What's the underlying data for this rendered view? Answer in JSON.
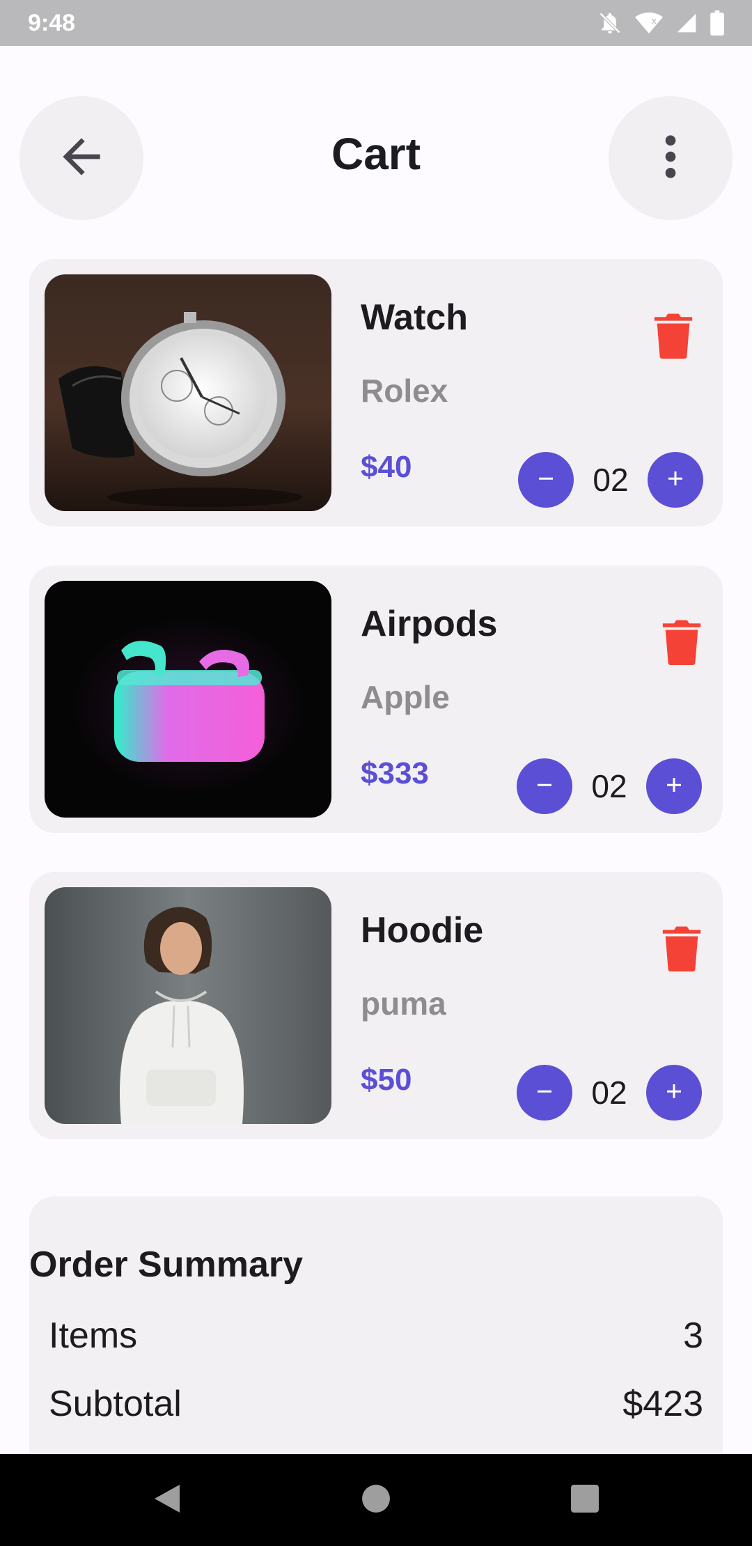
{
  "status_bar": {
    "time": "9:48",
    "icons": [
      "notifications-off-icon",
      "wifi-icon",
      "cell-signal-icon",
      "battery-icon"
    ]
  },
  "header": {
    "title": "Cart",
    "back_icon": "arrow-left-icon",
    "menu_icon": "more-vert-icon"
  },
  "cart": {
    "items": [
      {
        "name": "Watch",
        "brand": "Rolex",
        "price": "$40",
        "quantity": "02",
        "image": "watch-photo"
      },
      {
        "name": "Airpods",
        "brand": "Apple",
        "price": "$333",
        "quantity": "02",
        "image": "airpods-photo"
      },
      {
        "name": "Hoodie",
        "brand": "puma",
        "price": "$50",
        "quantity": "02",
        "image": "hoodie-photo"
      }
    ],
    "decrement_symbol": "–",
    "increment_symbol": "+"
  },
  "summary": {
    "title": "Order Summary",
    "rows": [
      {
        "label": "Items",
        "value": "3"
      },
      {
        "label": "Subtotal",
        "value": "$423"
      }
    ]
  },
  "colors": {
    "accent": "#5b4fd6",
    "delete": "#f44336",
    "card_bg": "#f3f0f3",
    "muted_text": "#8e8c90"
  }
}
